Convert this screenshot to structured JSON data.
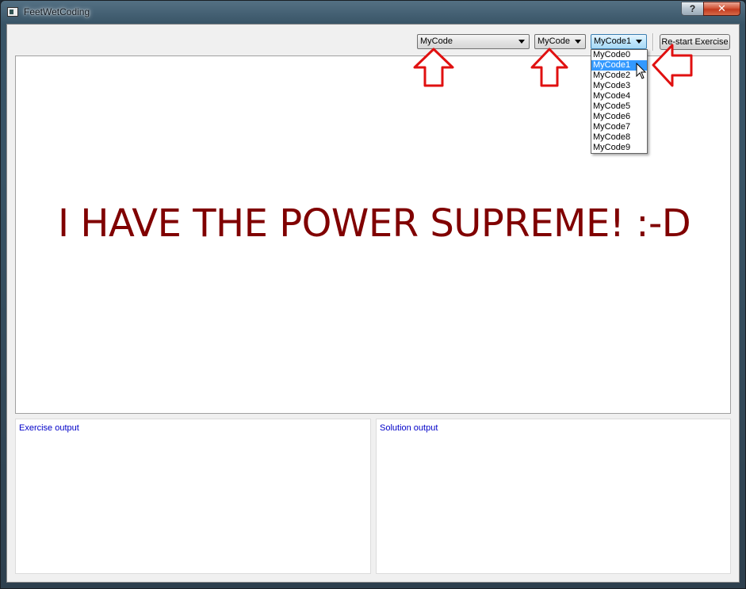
{
  "window": {
    "title": "FeetWetCoding"
  },
  "titlebar": {
    "help_label": "?",
    "close_label": "✕"
  },
  "toolbar": {
    "combo1_value": "MyCode",
    "combo2_value": "MyCode",
    "combo3_value": "MyCode1",
    "restart_label": "Re-start Exercise"
  },
  "dropdown": {
    "items": [
      "MyCode0",
      "MyCode1",
      "MyCode2",
      "MyCode3",
      "MyCode4",
      "MyCode5",
      "MyCode6",
      "MyCode7",
      "MyCode8",
      "MyCode9"
    ],
    "selected_index": 1
  },
  "canvas": {
    "message": "I HAVE THE POWER SUPREME! :-D",
    "message_color": "#800000"
  },
  "panels": {
    "exercise_label": "Exercise output",
    "solution_label": "Solution output",
    "label_color": "#0000c8"
  },
  "annotations": {
    "arrow_color": "#e01010"
  }
}
